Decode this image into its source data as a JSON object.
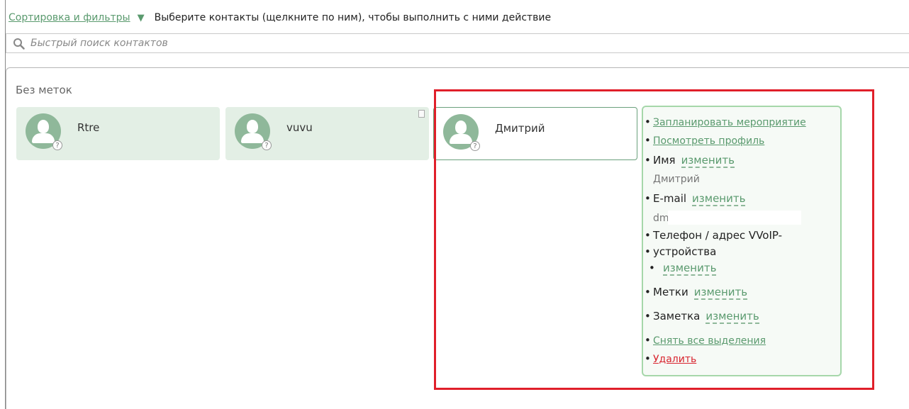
{
  "toolbar": {
    "sort_filter_label": "Сортировка и фильтры",
    "arrow": "▼",
    "hint": "Выберите контакты (щелкните по ним), чтобы выполнить с ними действие"
  },
  "search": {
    "placeholder": "Быстрый поиск контактов"
  },
  "group": {
    "title": "Без меток"
  },
  "contacts": [
    {
      "name": "Rtre",
      "badge": "?"
    },
    {
      "name": "vuvu",
      "badge": "?"
    },
    {
      "name": "Дмитрий",
      "badge": "?"
    }
  ],
  "popup": {
    "schedule": "Запланировать мероприятие",
    "profile": "Посмотреть профиль",
    "name_label": "Имя",
    "name_edit": "изменить",
    "name_value": "Дмитрий",
    "email_label": "E-mail",
    "email_edit": "изменить",
    "email_value": "dm",
    "phone_label_line1": "Телефон / адрес VVoIP-",
    "phone_label_line2": "устройства",
    "phone_edit": "изменить",
    "tags_label": "Метки",
    "tags_edit": "изменить",
    "note_label": "Заметка",
    "note_edit": "изменить",
    "deselect": "Снять все выделения",
    "delete": "Удалить"
  },
  "colors": {
    "accent": "#5a9a6e",
    "card_bg": "#e3efe5",
    "highlight": "#e01f2a",
    "danger": "#d8242e"
  }
}
